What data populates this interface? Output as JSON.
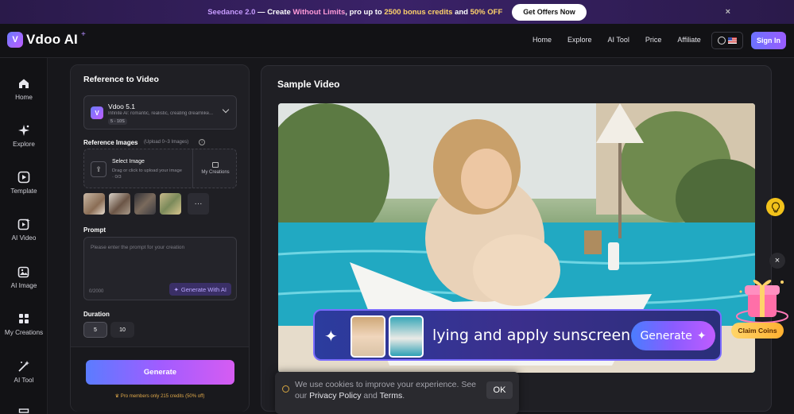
{
  "promo": {
    "part1": "Seedance 2.0",
    "part2": " — Create ",
    "part3": "Without Limits",
    "part4": ", pro up to ",
    "part5": "2500 bonus credits",
    "part6": " and ",
    "part7": "50% OFF",
    "cta": "Get Offers Now",
    "close": "×"
  },
  "brand": {
    "name": "Vdoo AI",
    "spark": "+"
  },
  "nav": {
    "links": [
      "Home",
      "Explore",
      "AI Tool",
      "Price",
      "Affiliate"
    ],
    "signin": "Sign In"
  },
  "sidebar": {
    "items": [
      {
        "label": "Home",
        "icon": "home-icon"
      },
      {
        "label": "Explore",
        "icon": "sparkle-icon"
      },
      {
        "label": "Template",
        "icon": "template-icon"
      },
      {
        "label": "AI Video",
        "icon": "ai-video-icon"
      },
      {
        "label": "AI Image",
        "icon": "ai-image-icon"
      },
      {
        "label": "My Creations",
        "icon": "grid-icon"
      },
      {
        "label": "AI Tool",
        "icon": "magic-wand-icon"
      }
    ]
  },
  "panel": {
    "title": "Reference to Video",
    "model": {
      "name": "Vdoo 5.1",
      "description": "Infinite AI: romantic, realistic, creating dreamlike...",
      "badge": "5 - 10S"
    },
    "reference": {
      "title": "Reference Images",
      "hint": "(Upload 0~3 Images)",
      "upload_title": "Select Image",
      "upload_sub": "Drag or click to upload your image · 0/3",
      "my_creations": "My Creations",
      "more": "···"
    },
    "prompt": {
      "title": "Prompt",
      "placeholder": "Please enter the prompt for your creation",
      "count": "0/2000",
      "ai_button": "Generate With AI"
    },
    "duration": {
      "title": "Duration",
      "options": [
        "5",
        "10"
      ],
      "selected": "5"
    },
    "generate": "Generate",
    "pro_note": "Pro members only 215 credits (50% off)"
  },
  "sample": {
    "title": "Sample Video",
    "caption": "lying and apply sunscreen",
    "cta": "Generate"
  },
  "cookie": {
    "text1": "We use cookies to improve your experience. See our ",
    "privacy": "Privacy Policy",
    "and": " and ",
    "terms": "Terms",
    "period": ".",
    "ok": "OK"
  },
  "floating": {
    "claim": "Claim Coins",
    "close": "×"
  },
  "colors": {
    "accent": "#7b6cff",
    "brand_gradient_start": "#5b7cff",
    "brand_gradient_end": "#d65cf2",
    "gold": "#f2c21b"
  }
}
